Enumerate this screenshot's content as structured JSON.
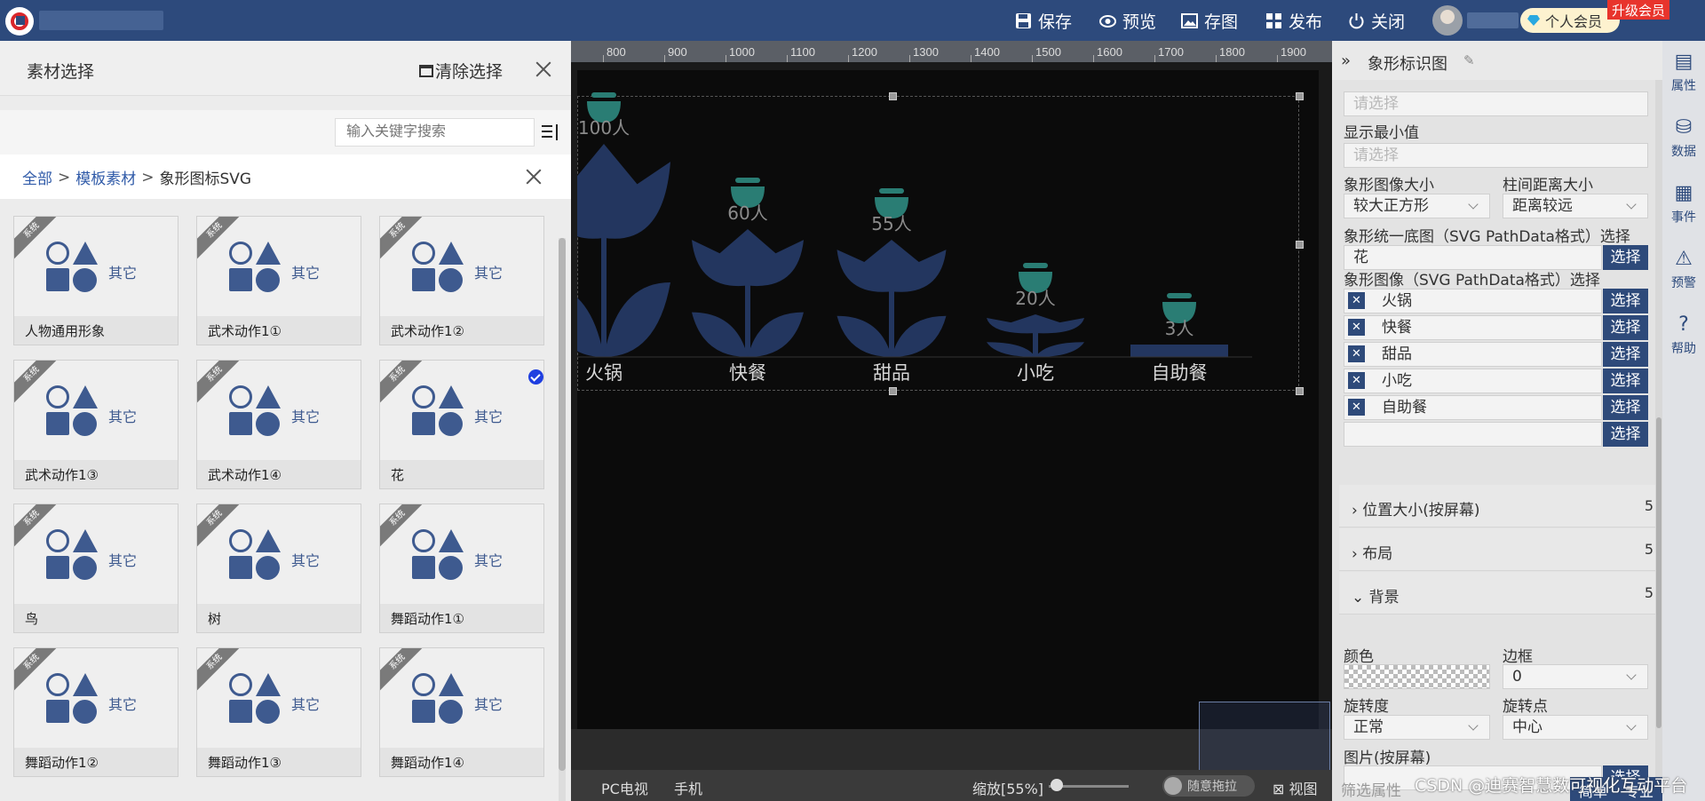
{
  "topbar": {
    "save": "保存",
    "preview": "预览",
    "snapshot": "存图",
    "publish": "发布",
    "close": "关闭",
    "member": "个人会员",
    "upgrade": "升级会员"
  },
  "left_panel": {
    "title": "素材选择",
    "clear": "清除选择",
    "search_placeholder": "输入关键字搜索",
    "breadcrumb": [
      "全部",
      "模板素材",
      "象形图标SVG"
    ],
    "badge": "系统",
    "category": "其它",
    "items": [
      {
        "name": "人物通用形象",
        "selected": false
      },
      {
        "name": "武术动作1①",
        "selected": false
      },
      {
        "name": "武术动作1②",
        "selected": false
      },
      {
        "name": "武术动作1③",
        "selected": false
      },
      {
        "name": "武术动作1④",
        "selected": false
      },
      {
        "name": "花",
        "selected": true
      },
      {
        "name": "鸟",
        "selected": false
      },
      {
        "name": "树",
        "selected": false
      },
      {
        "name": "舞蹈动作1①",
        "selected": false
      },
      {
        "name": "舞蹈动作1②",
        "selected": false
      },
      {
        "name": "舞蹈动作1③",
        "selected": false
      },
      {
        "name": "舞蹈动作1④",
        "selected": false
      }
    ]
  },
  "ruler": [
    "800",
    "900",
    "1000",
    "1100",
    "1200",
    "1300",
    "1400",
    "1500",
    "1600",
    "1700",
    "1800",
    "1900"
  ],
  "chart_data": {
    "type": "bar",
    "categories": [
      "火锅",
      "快餐",
      "甜品",
      "小吃",
      "自助餐"
    ],
    "values": [
      100,
      60,
      55,
      20,
      3
    ],
    "value_labels": [
      "100人",
      "60人",
      "55人",
      "20人",
      "3人"
    ],
    "icons": [
      "hotpot-icon",
      "burger-icon",
      "cake-icon",
      "noodle-icon",
      "bell-icon"
    ],
    "base_shape": "花",
    "colors": {
      "flower": "#23365f",
      "icon": "#2a7d74",
      "background": "#0b0b0b"
    }
  },
  "status_bar": {
    "pc": "PC电视",
    "mobile": "手机",
    "zoom": "缩放[55%]",
    "drag": "随意拖拉",
    "view": "视图"
  },
  "right_panel": {
    "title": "象形标识图",
    "min_display_label": "显示最小值",
    "placeholder": "请选择",
    "image_size_label": "象形图像大小",
    "image_size_value": "较大正方形",
    "gap_label": "柱间距离大小",
    "gap_value": "距离较远",
    "base_label": "象形统一底图（SVG PathData格式）选择",
    "base_value": "花",
    "images_label": "象形图像（SVG PathData格式）选择",
    "select_btn": "选择",
    "image_items": [
      "火锅",
      "快餐",
      "甜品",
      "小吃",
      "自助餐"
    ],
    "sections": [
      {
        "title": "位置大小(按屏幕)",
        "count": "5",
        "open": false
      },
      {
        "title": "布局",
        "count": "5",
        "open": false
      },
      {
        "title": "背景",
        "count": "5",
        "open": true
      }
    ],
    "color_label": "颜色",
    "border_label": "边框",
    "border_value": "0",
    "rotate_label": "旋转度",
    "rotate_value": "正常",
    "pivot_label": "旋转点",
    "pivot_value": "中心",
    "image_label": "图片(按屏幕)",
    "filter_label": "筛选属性",
    "simple": "简单",
    "pro": "专业"
  },
  "sidebar": [
    "属性",
    "数据",
    "事件",
    "预警",
    "帮助"
  ],
  "watermark": "CSDN @迪赛智慧数可视化互动平台",
  "accent": "#2d4a7c"
}
